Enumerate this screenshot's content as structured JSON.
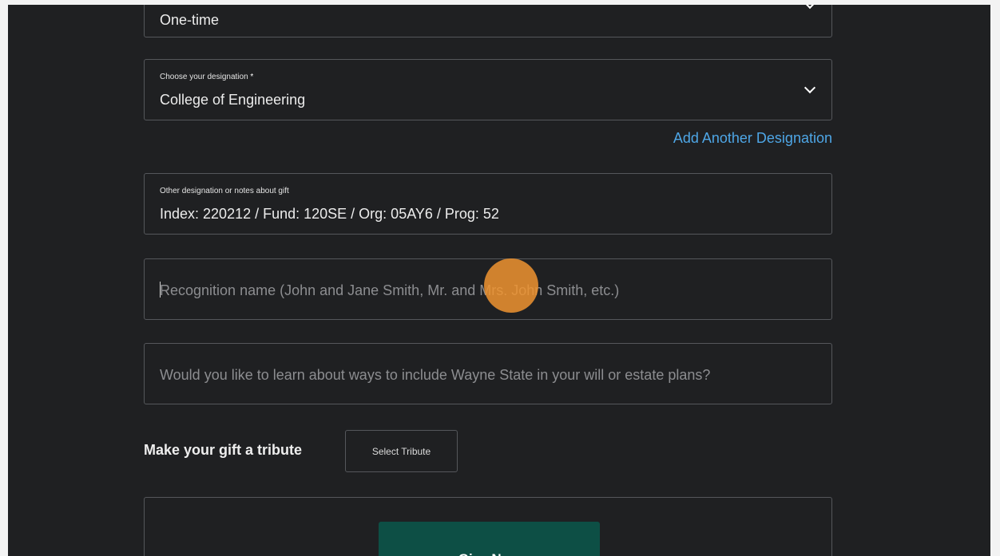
{
  "frequency": {
    "value": "One-time"
  },
  "designation": {
    "label": "Choose your designation",
    "required_mark": "*",
    "value": "College of Engineering"
  },
  "add_designation_link": "Add Another Designation",
  "notes": {
    "label": "Other designation or notes about gift",
    "value": "Index: 220212 / Fund: 120SE / Org: 05AY6 / Prog: 52"
  },
  "recognition": {
    "placeholder": "Recognition name (John and Jane Smith, Mr. and Mrs. John Smith, etc.)"
  },
  "estate": {
    "placeholder": "Would you like to learn about ways to include Wayne State in your will or estate plans?"
  },
  "tribute": {
    "label": "Make your gift a tribute",
    "button_label": "Select Tribute"
  },
  "give_button_label": "Give Now",
  "colors": {
    "background": "#1f2022",
    "accent_link": "#4ea6e6",
    "primary_button": "#0d4f45",
    "click_indicator": "#f09430"
  }
}
